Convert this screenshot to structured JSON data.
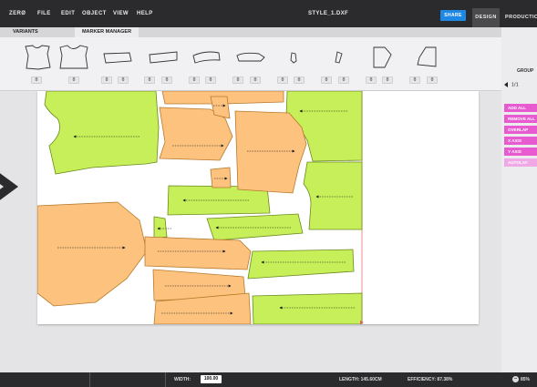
{
  "menu": {
    "logo": "ZERØ",
    "file": "FILE",
    "edit": "EDIT",
    "object": "OBJECT",
    "view": "VIEW",
    "help": "HELP",
    "file_name": "STYLE_1.DXF",
    "share": "SHARE",
    "design": "DESIGN",
    "production": "PRODUCTION"
  },
  "subtabs": {
    "variants": "VARIANTS",
    "marker_manager": "MARKER MANAGER"
  },
  "piece_quantities": [
    "0",
    "0",
    "0",
    "0",
    "0",
    "0",
    "0",
    "0",
    "0",
    "0",
    "0",
    "0",
    "0",
    "0",
    "0",
    "0",
    "0",
    "0"
  ],
  "right_panel": {
    "group_label": "GROUP",
    "group_page": "1/1",
    "buttons": [
      {
        "label": "ADD ALL",
        "enabled": true
      },
      {
        "label": "REMOVE ALL",
        "enabled": true
      },
      {
        "label": "OVERLAP",
        "enabled": true
      },
      {
        "label": "X AXIS",
        "enabled": true
      },
      {
        "label": "Y AXIS",
        "enabled": true
      },
      {
        "label": "AUTOLAY",
        "enabled": false
      }
    ]
  },
  "status": {
    "width_label": "WIDTH:",
    "width_value": "100.00",
    "length": "LENGTH: 145.60CM",
    "efficiency": "EFFICIENCY: 87.38%",
    "zoom": "85%"
  },
  "colors": {
    "green_piece": "#c6ef5a",
    "orange_piece": "#fcc27e",
    "accent_pink": "#e85bd0",
    "share_blue": "#1e88e5"
  }
}
